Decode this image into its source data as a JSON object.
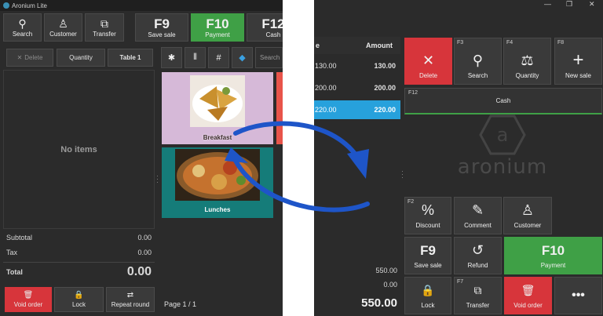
{
  "left": {
    "title": "Aronium Lite",
    "toolbar": [
      {
        "label": "Search",
        "icon": "search-icon",
        "glyph": "⚲"
      },
      {
        "label": "Customer",
        "icon": "customer-icon",
        "glyph": "♙"
      },
      {
        "label": "Transfer",
        "icon": "transfer-icon",
        "glyph": "⧉"
      }
    ],
    "fkeys": [
      {
        "key": "F9",
        "label": "Save sale"
      },
      {
        "key": "F10",
        "label": "Payment"
      },
      {
        "key": "F12",
        "label": "Cash"
      }
    ],
    "order_buttons": {
      "delete": "Delete",
      "quantity": "Quantity",
      "table": "Table 1"
    },
    "no_items": "No items",
    "summary": {
      "subtotal_label": "Subtotal",
      "subtotal": "0.00",
      "tax_label": "Tax",
      "tax": "0.00",
      "total_label": "Total",
      "total": "0.00"
    },
    "bottom_buttons": {
      "void": "Void order",
      "lock": "Lock",
      "repeat": "Repeat round"
    },
    "product_tools": {
      "star": "✱",
      "barcode": "⦀",
      "hash": "#",
      "tag": "◆",
      "search_placeholder": "Search"
    },
    "products": [
      {
        "label": "Breakfast",
        "bg": "#d6b9d8"
      },
      {
        "label": "Lunches",
        "bg": "#157c79"
      }
    ],
    "page": "Page 1 / 1"
  },
  "right": {
    "ticket": {
      "amount_header": "Amount",
      "col1_header": "e",
      "rows": [
        {
          "price": "130.00",
          "amount": "130.00",
          "selected": false
        },
        {
          "price": "200.00",
          "amount": "200.00",
          "selected": false
        },
        {
          "price": "220.00",
          "amount": "220.00",
          "selected": true
        }
      ],
      "subtotal": "550.00",
      "tax": "0.00",
      "total": "550.00"
    },
    "buttons_top": [
      {
        "fkey": "",
        "label": "Delete",
        "glyph": "✕",
        "style": "red"
      },
      {
        "fkey": "F3",
        "label": "Search",
        "glyph": "⚲",
        "style": ""
      },
      {
        "fkey": "F4",
        "label": "Quantity",
        "glyph": "⚖",
        "style": ""
      },
      {
        "fkey": "F8",
        "label": "New sale",
        "glyph": "+",
        "style": ""
      }
    ],
    "cash": {
      "fkey": "F12",
      "label": "Cash"
    },
    "logo": "aronium",
    "buttons_mid": [
      {
        "fkey": "F2",
        "label": "Discount",
        "glyph": "%"
      },
      {
        "fkey": "",
        "label": "Comment",
        "glyph": "✎"
      },
      {
        "fkey": "",
        "label": "Customer",
        "glyph": "♙"
      }
    ],
    "buttons_row3": [
      {
        "key": "F9",
        "label": "Save sale"
      },
      {
        "label": "Refund",
        "glyph": "↺"
      },
      {
        "key": "F10",
        "label": "Payment"
      }
    ],
    "buttons_row4": [
      {
        "fkey": "",
        "label": "Lock",
        "glyph": "🔒"
      },
      {
        "fkey": "F7",
        "label": "Transfer",
        "glyph": "⧉"
      },
      {
        "fkey": "",
        "label": "Void order",
        "glyph": "🗑"
      },
      {
        "fkey": "",
        "label": "",
        "glyph": "•••"
      }
    ],
    "window_controls": [
      "—",
      "❐",
      "✕"
    ]
  },
  "colors": {
    "accent_green": "#3fa046",
    "accent_red": "#d7353b",
    "selection_blue": "#27a1dc",
    "arrow_blue": "#1e55c8"
  }
}
